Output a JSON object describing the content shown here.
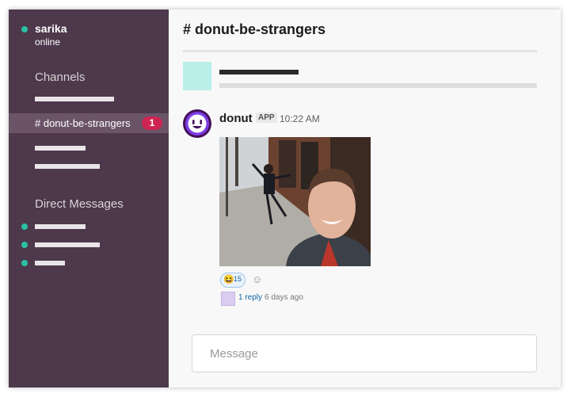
{
  "sidebar": {
    "user": {
      "name": "sarika",
      "status": "online"
    },
    "channels_title": "Channels",
    "active_channel": {
      "label": "# donut-be-strangers",
      "unread": "1"
    },
    "dm_title": "Direct Messages"
  },
  "channel": {
    "title": "# donut-be-strangers"
  },
  "message": {
    "sender": "donut",
    "tag": "APP",
    "time": "10:22 AM",
    "reaction": {
      "emoji": "😆",
      "count": "15"
    },
    "add_reaction_icon": "☺",
    "reply_count": "1 reply",
    "reply_time": "6 days ago"
  },
  "composer": {
    "placeholder": "Message"
  },
  "colors": {
    "sidebar": "#4d394b",
    "sidebar_active": "#6b5468",
    "presence": "#2bc0a6",
    "badge": "#cd2553",
    "link": "#1264a3",
    "avatar": "#44105b"
  }
}
